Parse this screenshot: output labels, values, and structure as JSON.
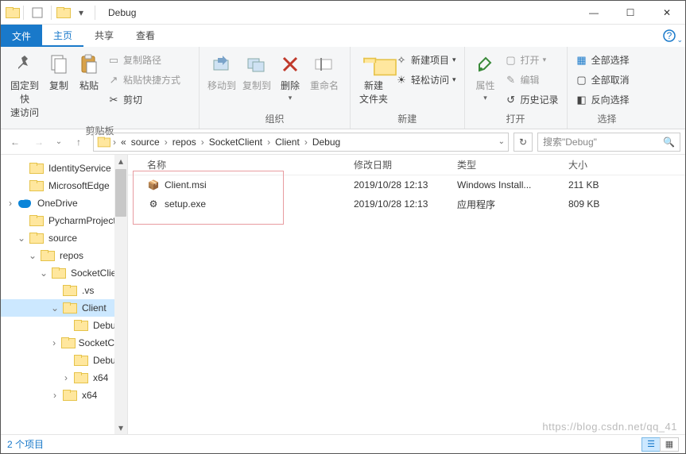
{
  "window": {
    "title": "Debug",
    "qat_down": "▾",
    "min": "—",
    "max": "☐",
    "close": "✕"
  },
  "tabs": {
    "file": "文件",
    "home": "主页",
    "share": "共享",
    "view": "查看",
    "help": "?"
  },
  "ribbon": {
    "clipboard": {
      "pin": "固定到快\n速访问",
      "copy": "复制",
      "paste": "粘贴",
      "copy_path": "复制路径",
      "paste_shortcut": "粘贴快捷方式",
      "cut": "剪切",
      "label": "剪贴板"
    },
    "organize": {
      "move_to": "移动到",
      "copy_to": "复制到",
      "delete": "删除",
      "rename": "重命名",
      "label": "组织"
    },
    "new": {
      "new_folder": "新建\n文件夹",
      "new_item": "新建项目",
      "easy_access": "轻松访问",
      "label": "新建"
    },
    "open": {
      "properties": "属性",
      "open": "打开",
      "edit": "编辑",
      "history": "历史记录",
      "label": "打开"
    },
    "select": {
      "select_all": "全部选择",
      "select_none": "全部取消",
      "invert": "反向选择",
      "label": "选择"
    }
  },
  "breadcrumbs": [
    "source",
    "repos",
    "SocketClient",
    "Client",
    "Debug"
  ],
  "nav": {
    "dropdown": "«"
  },
  "search": {
    "placeholder": "搜索\"Debug\""
  },
  "tree": [
    {
      "indent": 1,
      "label": "IdentityService",
      "icon": "folder"
    },
    {
      "indent": 1,
      "label": "MicrosoftEdge",
      "icon": "folder"
    },
    {
      "indent": 0,
      "label": "OneDrive",
      "icon": "onedrive",
      "tw": ">"
    },
    {
      "indent": 1,
      "label": "PycharmProject",
      "icon": "folder"
    },
    {
      "indent": 1,
      "label": "source",
      "icon": "folder",
      "tw": "v"
    },
    {
      "indent": 2,
      "label": "repos",
      "icon": "folder",
      "tw": "v"
    },
    {
      "indent": 3,
      "label": "SocketClient",
      "icon": "folder",
      "tw": "v"
    },
    {
      "indent": 4,
      "label": ".vs",
      "icon": "folder"
    },
    {
      "indent": 4,
      "label": "Client",
      "icon": "folder",
      "tw": "v",
      "selected": true
    },
    {
      "indent": 5,
      "label": "Debug",
      "icon": "folder"
    },
    {
      "indent": 4,
      "label": "SocketClier",
      "icon": "folder",
      "tw": ">"
    },
    {
      "indent": 5,
      "label": "Debug",
      "icon": "folder"
    },
    {
      "indent": 5,
      "label": "x64",
      "icon": "folder",
      "tw": ">"
    },
    {
      "indent": 4,
      "label": "x64",
      "icon": "folder",
      "tw": ">"
    }
  ],
  "columns": {
    "name": "名称",
    "date": "修改日期",
    "type": "类型",
    "size": "大小"
  },
  "files": [
    {
      "icon": "msi",
      "name": "Client.msi",
      "date": "2019/10/28 12:13",
      "type": "Windows Install...",
      "size": "211 KB"
    },
    {
      "icon": "exe",
      "name": "setup.exe",
      "date": "2019/10/28 12:13",
      "type": "应用程序",
      "size": "809 KB"
    }
  ],
  "status": {
    "count": "2 个项目"
  },
  "watermark": "https://blog.csdn.net/qq_41"
}
